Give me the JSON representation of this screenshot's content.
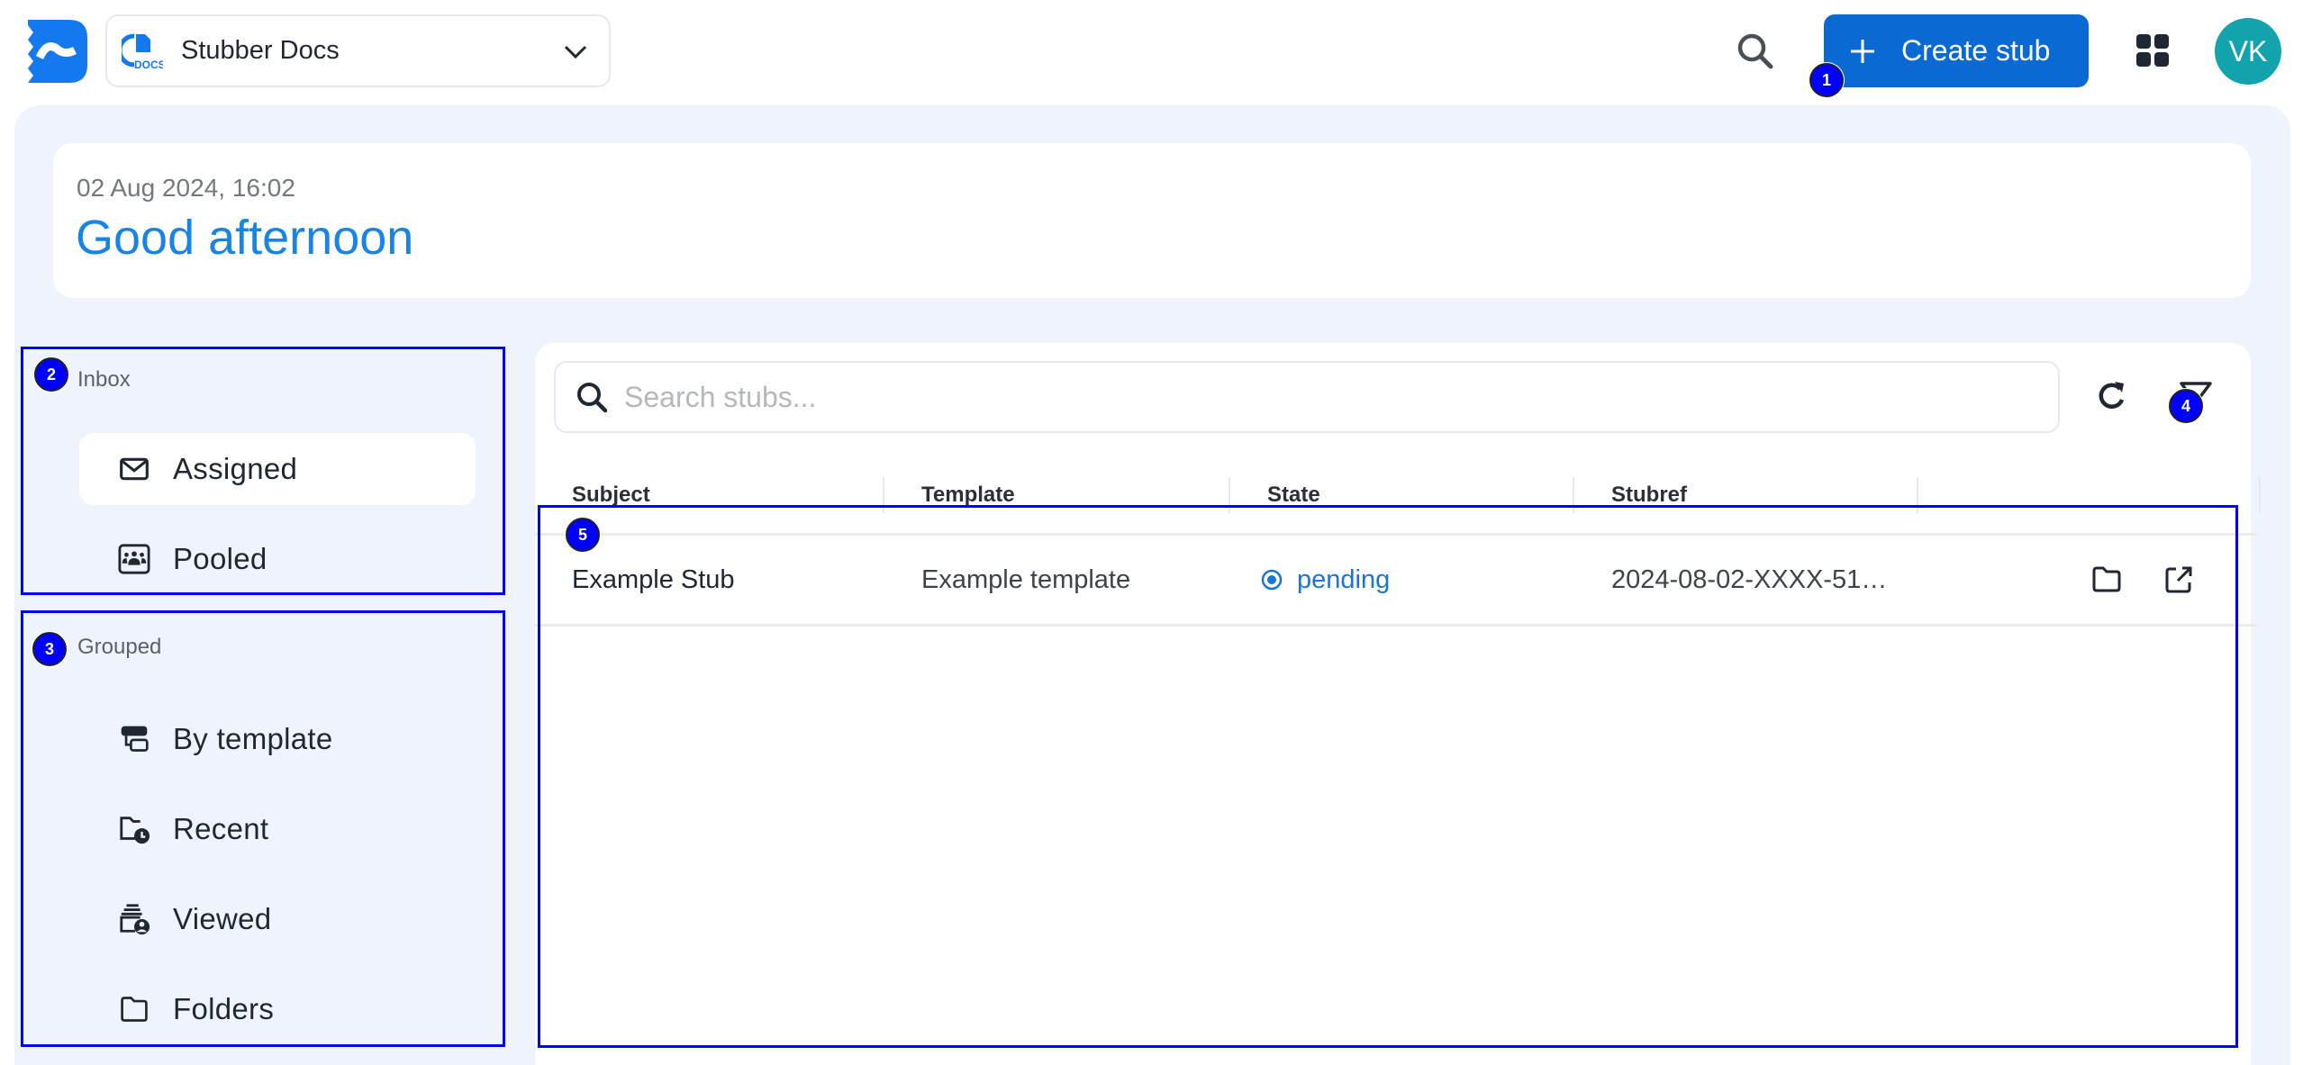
{
  "topbar": {
    "logo_icon": "stubber-logo-icon",
    "app_selector": {
      "label": "Stubber Docs",
      "icon": "docs-app-icon",
      "chevron": "chevron-down-icon"
    },
    "search_icon": "search-icon",
    "create_button": {
      "label": "Create stub",
      "icon": "plus-icon"
    },
    "apps_icon": "apps-grid-icon",
    "avatar_initials": "VK"
  },
  "greeting": {
    "date": "02 Aug 2024, 16:02",
    "title": "Good afternoon"
  },
  "sidebar": {
    "inbox": {
      "label": "Inbox",
      "items": [
        {
          "label": "Assigned",
          "icon": "envelope-icon",
          "active": true
        },
        {
          "label": "Pooled",
          "icon": "group-icon",
          "active": false
        }
      ]
    },
    "grouped": {
      "label": "Grouped",
      "items": [
        {
          "label": "By template",
          "icon": "template-icon"
        },
        {
          "label": "Recent",
          "icon": "folder-clock-icon"
        },
        {
          "label": "Viewed",
          "icon": "stack-user-icon"
        },
        {
          "label": "Folders",
          "icon": "folder-icon"
        }
      ]
    }
  },
  "stubs": {
    "search_placeholder": "Search stubs...",
    "search_value": "",
    "refresh_icon": "refresh-icon",
    "filter_icon": "filter-icon",
    "columns": [
      "Subject",
      "Template",
      "State",
      "Stubref",
      ""
    ],
    "rows": [
      {
        "subject": "Example Stub",
        "template": "Example template",
        "state": "pending",
        "stubref": "2024-08-02-XXXX-51…",
        "actions": [
          "folder-icon",
          "open-external-icon"
        ]
      }
    ]
  },
  "annotations": [
    "1",
    "2",
    "3",
    "4",
    "5"
  ],
  "colors": {
    "brand": "#0b69d4",
    "accent_text": "#1a84e5",
    "avatar": "#13a3ad",
    "panel_bg": "#eff4fc",
    "state_pending": "#1a75d4"
  }
}
